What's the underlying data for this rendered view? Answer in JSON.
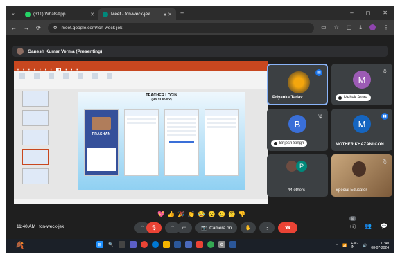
{
  "browser": {
    "tabs": [
      {
        "label": "(311) WhatsApp",
        "active": false,
        "color": "#25d366"
      },
      {
        "label": "Meet - fcn-weck-jek",
        "active": true,
        "color": "#00897b"
      }
    ],
    "url": "meet.google.com/fcn-weck-jek"
  },
  "meet": {
    "presenter_label": "Ganesh Kumar Verma (Presenting)",
    "reactions": [
      "💖",
      "👍",
      "🎉",
      "👏",
      "😂",
      "😮",
      "😢",
      "🤔",
      "👎"
    ],
    "time_code": "11:40 AM | fcn-weck-jek",
    "camera_label": "Camera on",
    "participant_count": "50",
    "participants": [
      {
        "name": "Priyanka Tadav",
        "type": "flower"
      },
      {
        "name": "Mehak Arora",
        "initial": "M",
        "color": "#9c5bb5"
      },
      {
        "name": "Brijesh Singh",
        "initial": "B",
        "color": "#3a6fd8"
      },
      {
        "name": "MOTHER KHAZANI CON...",
        "initial": "M",
        "color": "#1565c0"
      },
      {
        "name": "44 others",
        "initial": "P",
        "color": "#00897b"
      },
      {
        "name": "Special Educator",
        "type": "video"
      }
    ]
  },
  "slide": {
    "title": "TEACHER LOGIN",
    "subtitle": "(MY SURVEY)",
    "brand": "PRASHAN"
  },
  "taskbar": {
    "lang": "ENG\nIN",
    "time": "11:40",
    "date": "08-07-2024"
  }
}
